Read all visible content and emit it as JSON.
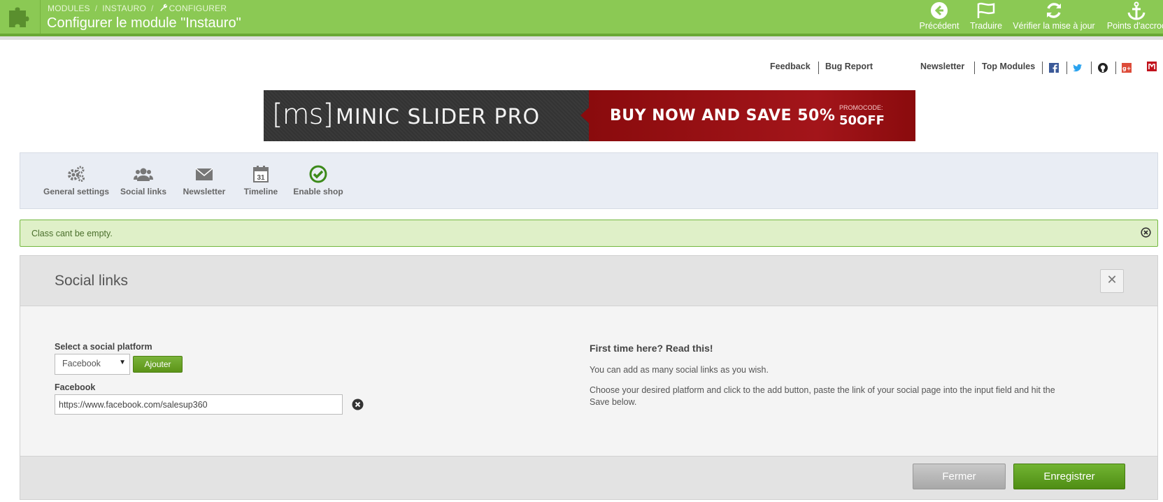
{
  "header": {
    "breadcrumb": [
      "MODULES",
      "INSTAURO",
      "CONFIGURER"
    ],
    "breadcrumb_separator": "/",
    "title": "Configurer le module \"Instauro\"",
    "toolbar": [
      {
        "label": "Précédent",
        "icon": "arrow-left-circle-icon"
      },
      {
        "label": "Traduire",
        "icon": "flag-icon"
      },
      {
        "label": "Vérifier la mise à jour",
        "icon": "refresh-icon"
      },
      {
        "label": "Points d'accroc",
        "icon": "anchor-icon"
      }
    ],
    "colors": {
      "bar": "#8bc954",
      "bar_dark": "#6aa935"
    }
  },
  "ext_links": {
    "feedback": "Feedback",
    "bug_report": "Bug Report",
    "newsletter": "Newsletter",
    "top_modules": "Top Modules",
    "social_icons": [
      "facebook-icon",
      "twitter-icon",
      "github-icon",
      "google-plus-icon",
      "m-brand-icon"
    ]
  },
  "banner": {
    "logo": "[ms]",
    "title": "MINIC SLIDER PRO",
    "cta": "BUY NOW AND SAVE 50%",
    "promo_label": "PROMOCODE:",
    "promo_code": "50OFF"
  },
  "tabs": [
    {
      "label": "General settings",
      "icon": "gears-icon"
    },
    {
      "label": "Social links",
      "icon": "users-icon"
    },
    {
      "label": "Newsletter",
      "icon": "envelope-icon"
    },
    {
      "label": "Timeline",
      "icon": "calendar-icon",
      "calendar_day": "31"
    },
    {
      "label": "Enable shop",
      "icon": "check-circle-icon"
    }
  ],
  "alert": {
    "text": "Class cant be empty.",
    "color": "#dff0c8"
  },
  "panel": {
    "title": "Social links",
    "platform_label": "Select a social platform",
    "platform_selected": "Facebook",
    "add_button": "Ajouter",
    "link_label": "Facebook",
    "link_value": "https://www.facebook.com/salesup360",
    "help_title": "First time here? Read this!",
    "help_p1": "You can add as many social links as you wish.",
    "help_p2a": "Choose your desired platform and click to the add button, paste the link of your social page into the input field and hit the",
    "help_p2b": "Save below.",
    "close_button": "Fermer",
    "save_button": "Enregistrer"
  }
}
